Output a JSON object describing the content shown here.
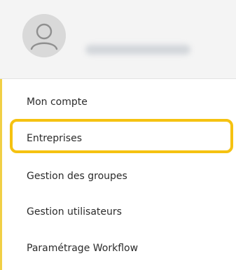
{
  "menu": {
    "items": [
      {
        "label": "Mon compte"
      },
      {
        "label": "Entreprises"
      },
      {
        "label": "Gestion des groupes"
      },
      {
        "label": "Gestion utilisateurs"
      },
      {
        "label": "Paramétrage Workflow"
      }
    ]
  },
  "icons": {
    "avatar": "user-avatar-icon"
  },
  "colors": {
    "highlight": "#f5c211",
    "rail": "#f1cf45",
    "profile_bg": "#f4f4f4"
  }
}
